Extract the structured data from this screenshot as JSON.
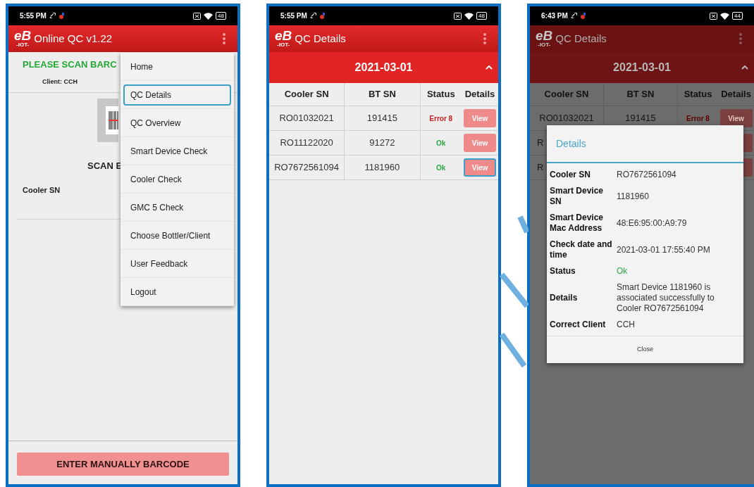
{
  "screens": [
    {
      "kind": "home",
      "status_bar": {
        "time": "5:55 PM",
        "battery": "48"
      },
      "app_bar": {
        "logo": "eB",
        "logo_sub": "-IOT-",
        "title": "Online QC v1.22"
      },
      "prompt": "PLEASE SCAN BARC",
      "client": "Client: CCH",
      "scan_label": "SCAN E",
      "field_label": "Cooler SN",
      "button": "ENTER MANUALLY BARCODE",
      "menu": [
        {
          "label": "Home",
          "selected": false
        },
        {
          "label": "QC Details",
          "selected": true
        },
        {
          "label": "QC Overview",
          "selected": false
        },
        {
          "label": "Smart Device Check",
          "selected": false
        },
        {
          "label": "Cooler Check",
          "selected": false
        },
        {
          "label": "GMC 5 Check",
          "selected": false
        },
        {
          "label": "Choose Bottler/Client",
          "selected": false
        },
        {
          "label": "User Feedback",
          "selected": false
        },
        {
          "label": "Logout",
          "selected": false
        }
      ]
    },
    {
      "kind": "list",
      "status_bar": {
        "time": "5:55 PM",
        "battery": "48"
      },
      "app_bar": {
        "logo": "eB",
        "logo_sub": "-IOT-",
        "title": "QC Details"
      },
      "date": "2021-03-01",
      "expanded": true,
      "columns": [
        "Cooler SN",
        "BT SN",
        "Status",
        "Details"
      ],
      "rows": [
        {
          "cooler_sn": "RO01032021",
          "bt_sn": "191415",
          "status": "Error 8",
          "kind": "error",
          "action": "View",
          "selected": false
        },
        {
          "cooler_sn": "RO11122020",
          "bt_sn": "91272",
          "status": "Ok",
          "kind": "ok",
          "action": "View",
          "selected": false
        },
        {
          "cooler_sn": "RO7672561094",
          "bt_sn": "1181960",
          "status": "Ok",
          "kind": "ok",
          "action": "View",
          "selected": true
        }
      ]
    },
    {
      "kind": "dialog",
      "status_bar": {
        "time": "6:43 PM",
        "battery": "44"
      },
      "app_bar": {
        "logo": "eB",
        "logo_sub": "-IOT-",
        "title": "QC Details"
      },
      "date": "2021-03-01",
      "expanded": true,
      "columns": [
        "Cooler SN",
        "BT SN",
        "Status",
        "Details"
      ],
      "rows": [
        {
          "cooler_sn": "RO01032021",
          "bt_sn": "191415",
          "status": "Error 8",
          "kind": "error",
          "action": "View",
          "selected": false
        },
        {
          "cooler_sn": "R",
          "kind": "partial"
        },
        {
          "cooler_sn": "R",
          "kind": "partial"
        }
      ],
      "dialog": {
        "title": "Details",
        "fields": [
          {
            "label": "Cooler SN",
            "value": "RO7672561094",
            "kind": "text"
          },
          {
            "label": "Smart Device SN",
            "value": "1181960",
            "kind": "text"
          },
          {
            "label": "Smart Device Mac Address",
            "value": "48:E6:95:00:A9:79",
            "kind": "text"
          },
          {
            "label": "Check date and time",
            "value": "2021-03-01 17:55:40 PM",
            "kind": "text"
          },
          {
            "label": "Status",
            "value": "Ok",
            "kind": "status"
          },
          {
            "label": "Details",
            "value": "Smart Device 1181960 is associated successfully to Cooler RO7672561094",
            "kind": "text"
          },
          {
            "label": "Correct Client",
            "value": "CCH",
            "kind": "text"
          }
        ],
        "button": "Close"
      }
    }
  ]
}
